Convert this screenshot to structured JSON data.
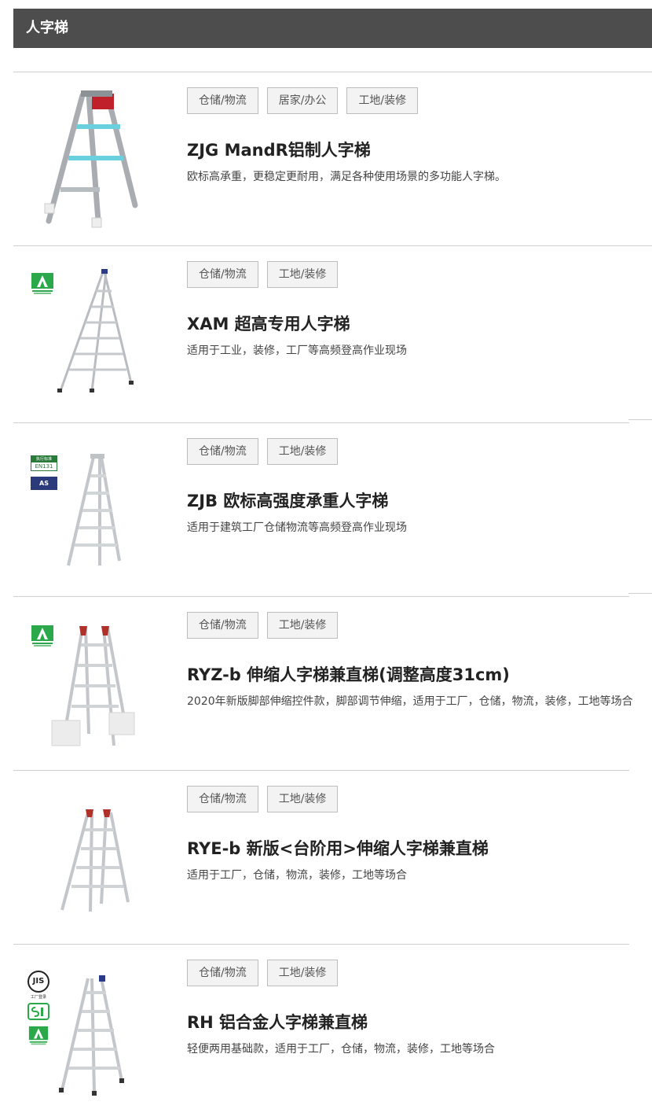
{
  "header": {
    "title": "人字梯"
  },
  "products": [
    {
      "tags": [
        "仓储/物流",
        "居家/办公",
        "工地/装修"
      ],
      "title": "ZJG MandR铝制人字梯",
      "description": "欧标高承重，更稳定更耐用，满足各种使用场景的多功能人字梯。",
      "badges": [],
      "accent": "#6ad0de"
    },
    {
      "tags": [
        "仓储/物流",
        "工地/装修"
      ],
      "title": "XAM 超高专用人字梯",
      "description": "适用于工业，装修，工厂等高频登高作业现场",
      "badges": [
        "green-mark"
      ],
      "accent": "#2a3a8a"
    },
    {
      "tags": [
        "仓储/物流",
        "工地/装修"
      ],
      "title": "ZJB 欧标高强度承重人字梯",
      "description": "适用于建筑工厂仓储物流等高频登高作业现场",
      "badges": [
        "en131",
        "as"
      ],
      "badge_text": {
        "en_top": "执行标准",
        "en_code": "EN131",
        "as_code": "AS"
      },
      "accent": "#c9c9c9"
    },
    {
      "tags": [
        "仓储/物流",
        "工地/装修"
      ],
      "title": "RYZ-b 伸缩人字梯兼直梯(调整高度31cm)",
      "description": "2020年新版脚部伸缩控件款，脚部调节伸缩，适用于工厂，仓储，物流，装修，工地等场合",
      "badges": [
        "green-mark"
      ],
      "accent": "#b0302a"
    },
    {
      "tags": [
        "仓储/物流",
        "工地/装修"
      ],
      "title": "RYE-b 新版<台阶用>伸缩人字梯兼直梯",
      "description": "适用于工厂，仓储，物流，装修，工地等场合",
      "badges": [],
      "accent": "#b0302a"
    },
    {
      "tags": [
        "仓储/物流",
        "工地/装修"
      ],
      "title": "RH 铝合金人字梯兼直梯",
      "description": "轻便两用基础款，适用于工厂，仓储，物流，装修，工地等场合",
      "badges": [
        "jis",
        "si",
        "green-mark"
      ],
      "badge_text": {
        "jis": "JIS",
        "jis_sub": "工厂登录"
      },
      "accent": "#2a3a8a"
    }
  ]
}
